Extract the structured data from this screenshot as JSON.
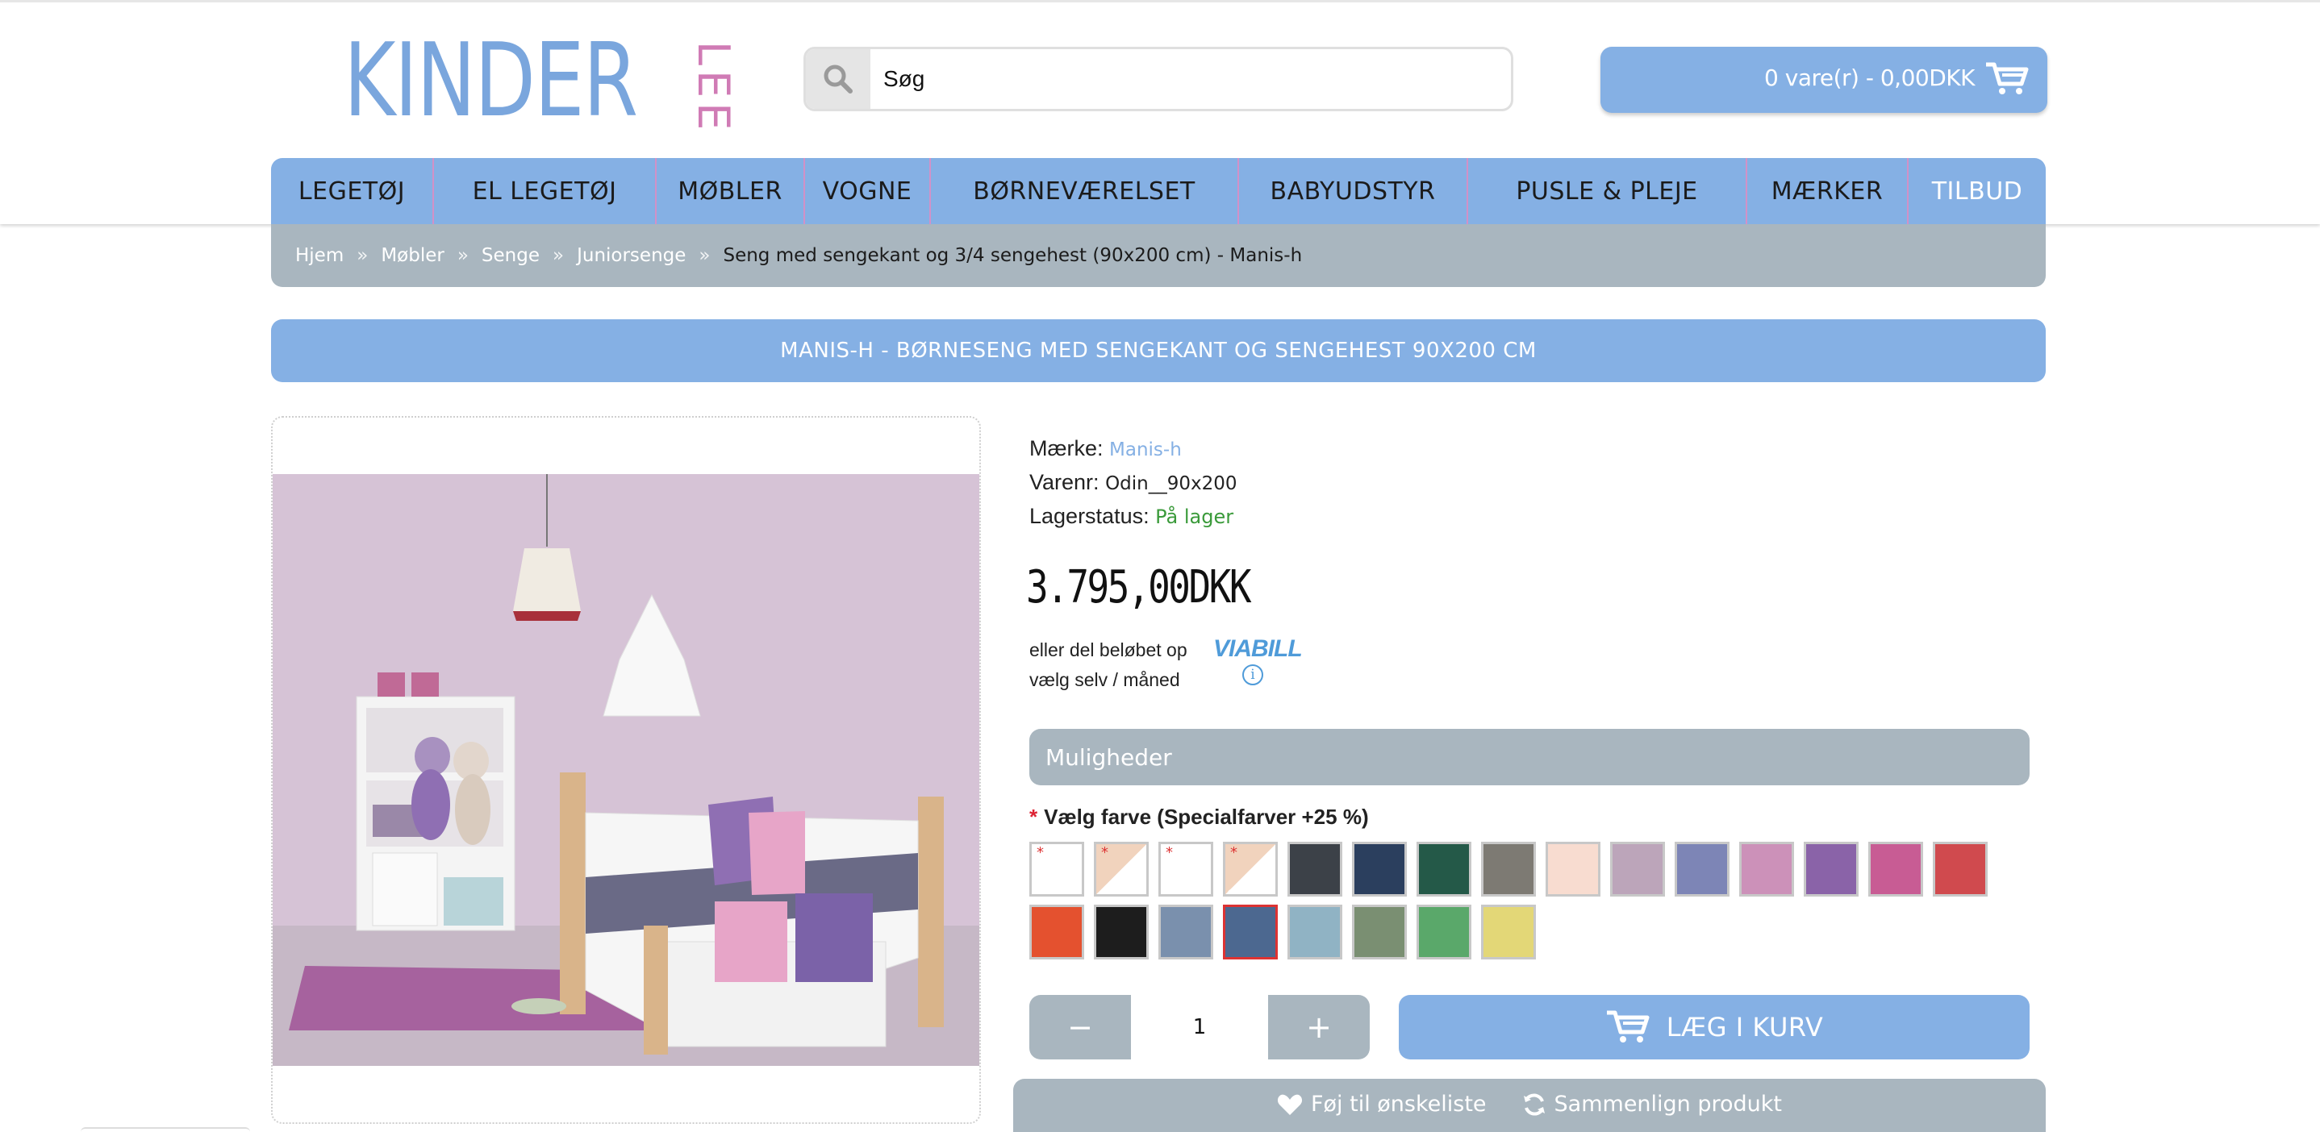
{
  "colors": {
    "brand_blue": "#85b0e4",
    "brand_gray": "#a9b6bf",
    "logo_pink": "#d07bb5",
    "in_stock": "#3a9a3a",
    "required": "#dd2233"
  },
  "header": {
    "logo": {
      "main": "KINDER",
      "side": "LEE"
    },
    "search": {
      "placeholder": "Søg",
      "icon": "search-icon"
    },
    "cart": {
      "label": "0 vare(r) - 0,00DKK",
      "icon": "cart-icon"
    }
  },
  "nav": {
    "items": [
      {
        "label": "LEGETØJ"
      },
      {
        "label": "EL LEGETØJ"
      },
      {
        "label": "MØBLER"
      },
      {
        "label": "VOGNE"
      },
      {
        "label": "BØRNEVÆRELSET"
      },
      {
        "label": "BABYUDSTYR"
      },
      {
        "label": "PUSLE & PLEJE"
      },
      {
        "label": "MÆRKER"
      },
      {
        "label": "TILBUD"
      }
    ]
  },
  "breadcrumb": {
    "separator": "»",
    "items": [
      "Hjem",
      "Møbler",
      "Senge",
      "Juniorsenge"
    ],
    "current": "Seng med sengekant og 3/4 sengehest (90x200 cm) - Manis-h"
  },
  "product": {
    "title": "MANIS-H - BØRNESENG MED SENGEKANT OG SENGEHEST 90X200 CM",
    "brand_label": "Mærke:",
    "brand": "Manis-h",
    "sku_label": "Varenr:",
    "sku": "Odin__90x200",
    "stock_label": "Lagerstatus:",
    "stock": "På lager",
    "price": "3.795,00DKK",
    "financing": {
      "line1": "eller del beløbet op",
      "line2": "vælg selv / måned",
      "provider": "VIABILL",
      "info_glyph": "i"
    },
    "options_title": "Muligheder",
    "color_label": "Vælg farve (Specialfarver +25 %)",
    "required_mark": "*",
    "swatches": [
      {
        "color": "#ffffff",
        "star": "*"
      },
      {
        "color": "diag-natural",
        "star": "*"
      },
      {
        "color": "#ffffff",
        "star": "*"
      },
      {
        "color": "diag-natural",
        "star": "*"
      },
      {
        "color": "#3c4148"
      },
      {
        "color": "#2b3f5e"
      },
      {
        "color": "#245948"
      },
      {
        "color": "#7d7a73"
      },
      {
        "color": "#f8dcd0"
      },
      {
        "color": "#bca5ba"
      },
      {
        "color": "#7d85b6"
      },
      {
        "color": "#cc91b9"
      },
      {
        "color": "#8a63a8"
      },
      {
        "color": "#c85c94"
      },
      {
        "color": "#d04a4e"
      },
      {
        "color": "#e4512f"
      },
      {
        "color": "#1d1d1d"
      },
      {
        "color": "#7a90ad"
      },
      {
        "color": "#4c6890",
        "selected": true
      },
      {
        "color": "#90b3c4"
      },
      {
        "color": "#7a8f72"
      },
      {
        "color": "#5aa86a"
      },
      {
        "color": "#e3d777"
      }
    ],
    "quantity": {
      "minus": "−",
      "value": "1",
      "plus": "+"
    },
    "add_to_cart": "LÆG I KURV",
    "wishlist": "Føj til ønskeliste",
    "compare": "Sammenlign produkt"
  }
}
